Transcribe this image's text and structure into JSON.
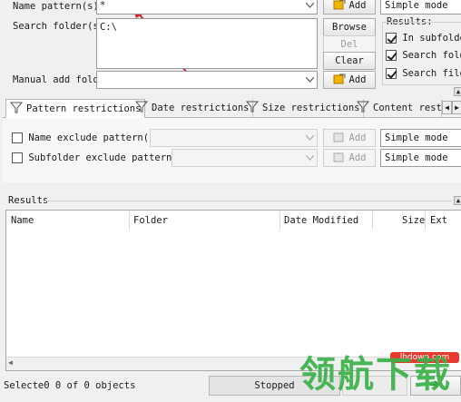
{
  "name_pattern": {
    "label": "Name pattern(s):",
    "value": "*"
  },
  "search_folder": {
    "label": "Search folder(s):",
    "value": "C:\\"
  },
  "manual_add": {
    "label": "Manual add folder",
    "value": ""
  },
  "buttons": {
    "add": "Add",
    "browse": "Browse",
    "del": "Del",
    "clear": "Clear"
  },
  "mode": {
    "simple": "Simple mode"
  },
  "results_options": {
    "title": "Results:",
    "items": [
      {
        "label": "In subfolders",
        "checked": true
      },
      {
        "label": "Search folders",
        "checked": true
      },
      {
        "label": "Search files",
        "checked": true
      }
    ]
  },
  "tabs": [
    {
      "label": "Pattern restrictions",
      "active": true
    },
    {
      "label": "Date restrictions",
      "active": false
    },
    {
      "label": "Size restrictions",
      "active": false
    },
    {
      "label": "Content restri",
      "active": false
    }
  ],
  "restrictions": {
    "name_exclude": "Name exclude pattern(s):",
    "subfolder_exclude": "Subfolder exclude pattern(s):"
  },
  "results": {
    "title": "Results",
    "columns": [
      "Name",
      "Folder",
      "Date Modified",
      "Size",
      "Ext"
    ]
  },
  "status": {
    "selected": "Selecte0 0 of 0 objects",
    "state": "Stopped"
  },
  "watermark": {
    "domain": "lhdown.com",
    "text": "领航下载"
  },
  "colors": {
    "arrow": "#d0232a",
    "accent_red": "#e63a2e",
    "add_icon": "#f3b400"
  }
}
